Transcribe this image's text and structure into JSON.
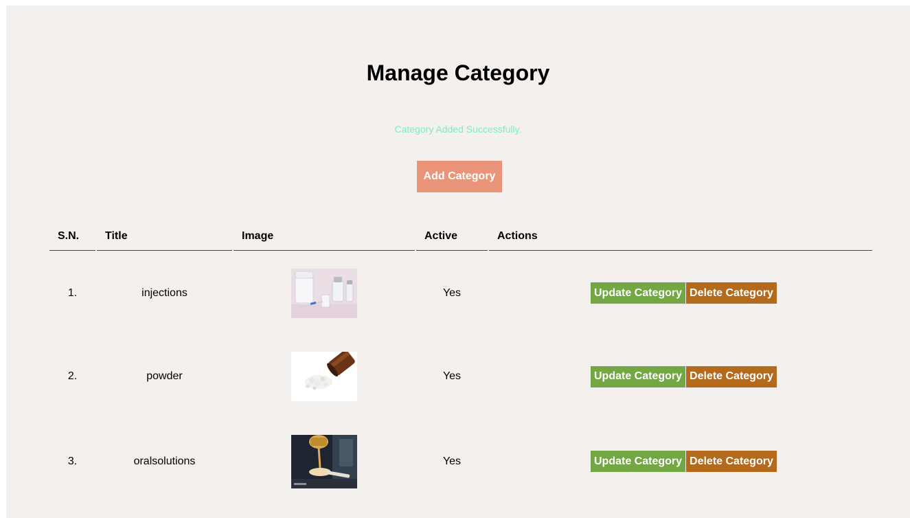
{
  "page": {
    "title": "Manage Category",
    "flash_message": "Category Added Successfully.",
    "add_button_label": "Add Category"
  },
  "table": {
    "headers": [
      "S.N.",
      "Title",
      "Image",
      "Active",
      "Actions"
    ],
    "rows": [
      {
        "sn": "1.",
        "title": "injections",
        "image_icon": "injection-vials-image",
        "active": "Yes",
        "update_label": "Update Category",
        "delete_label": "Delete Category"
      },
      {
        "sn": "2.",
        "title": "powder",
        "image_icon": "powder-bottle-image",
        "active": "Yes",
        "update_label": "Update Category",
        "delete_label": "Delete Category"
      },
      {
        "sn": "3.",
        "title": "oralsolutions",
        "image_icon": "oral-solution-spoon-image",
        "active": "Yes",
        "update_label": "Update Category",
        "delete_label": "Delete Category"
      }
    ]
  },
  "colors": {
    "panel_bg": "#f4f0ed",
    "flash_text": "#7dedc1",
    "add_button": "#ea9579",
    "update_button": "#72a743",
    "delete_button": "#b46a1c"
  }
}
